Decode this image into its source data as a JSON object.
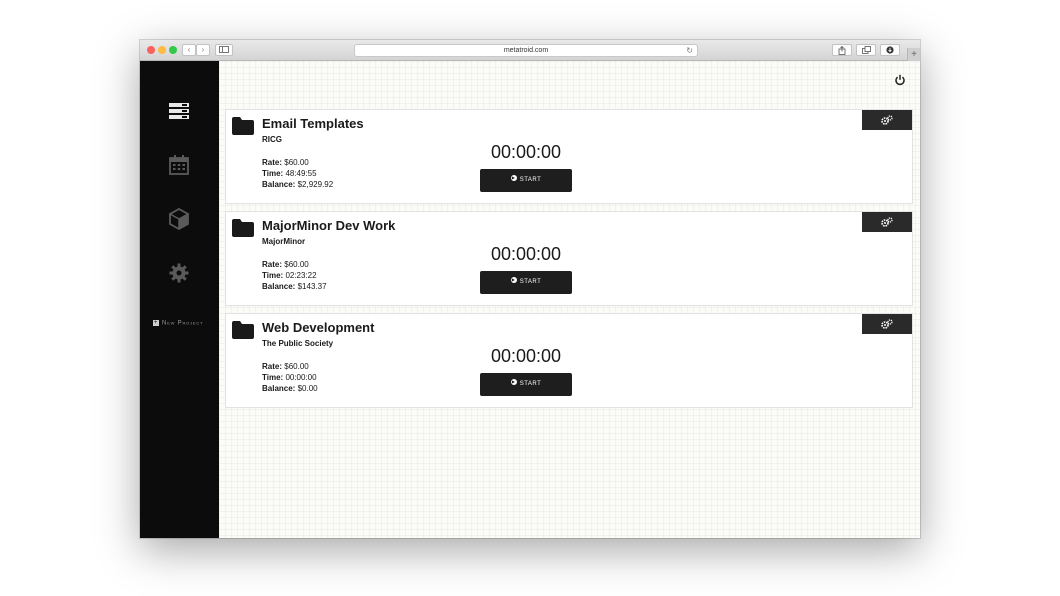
{
  "browser": {
    "url": "metatroid.com",
    "back_glyph": "‹",
    "forward_glyph": "›",
    "reload_glyph": "↻",
    "new_tab_glyph": "+"
  },
  "sidebar": {
    "items": [
      {
        "icon": "projects-list-icon"
      },
      {
        "icon": "calendar-icon"
      },
      {
        "icon": "box-icon"
      },
      {
        "icon": "gear-icon"
      }
    ],
    "new_project_label": "New Project",
    "new_project_glyph": "+"
  },
  "header": {
    "icon": "power-icon"
  },
  "projects": [
    {
      "name": "Email Templates",
      "client": "RICG",
      "rate_label": "Rate:",
      "rate": "$60.00",
      "time_label": "Time:",
      "time": "48:49:55",
      "balance_label": "Balance:",
      "balance": "$2,929.92",
      "timer": "00:00:00",
      "start_label": "START"
    },
    {
      "name": "MajorMinor Dev Work",
      "client": "MajorMinor",
      "rate_label": "Rate:",
      "rate": "$60.00",
      "time_label": "Time:",
      "time": "02:23:22",
      "balance_label": "Balance:",
      "balance": "$143.37",
      "timer": "00:00:00",
      "start_label": "START"
    },
    {
      "name": "Web Development",
      "client": "The Public Society",
      "rate_label": "Rate:",
      "rate": "$60.00",
      "time_label": "Time:",
      "time": "00:00:00",
      "balance_label": "Balance:",
      "balance": "$0.00",
      "timer": "00:00:00",
      "start_label": "START"
    }
  ],
  "colors": {
    "sidebar_bg": "#0c0c0c",
    "button_dark": "#1e1e1e",
    "card_bg": "#ffffff",
    "traffic_red": "#fc605c",
    "traffic_yellow": "#fdbc40",
    "traffic_green": "#34c84a"
  }
}
